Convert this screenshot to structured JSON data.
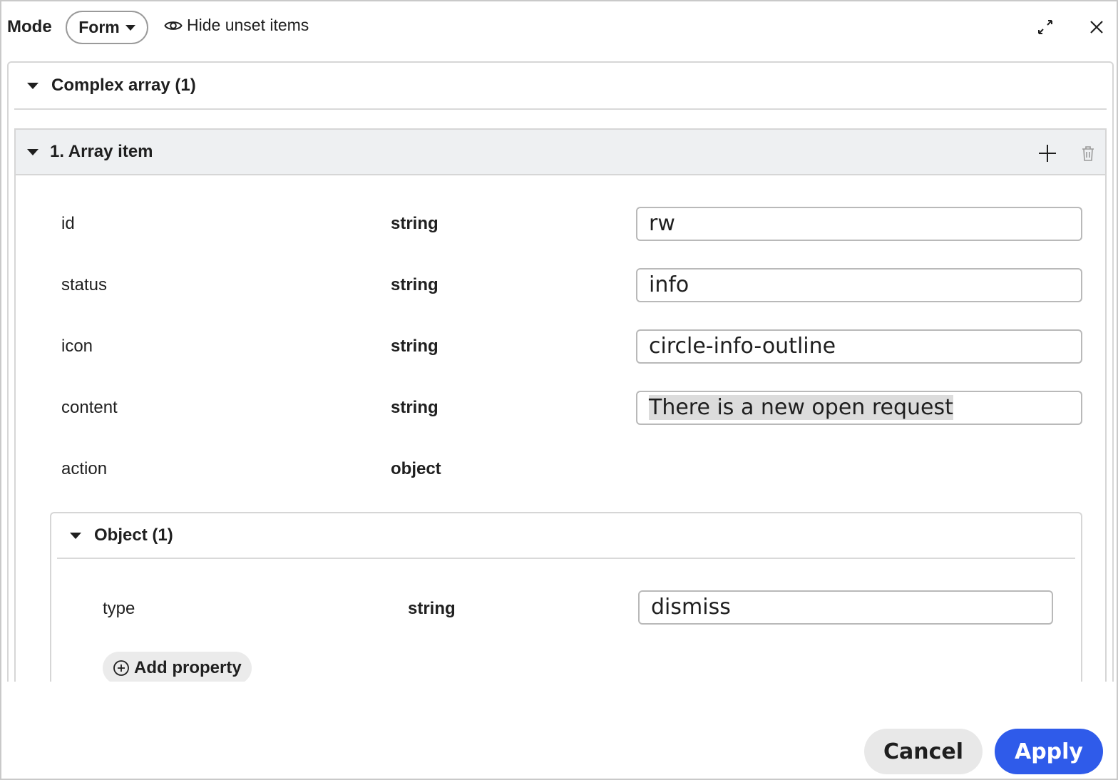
{
  "toolbar": {
    "mode_label": "Mode",
    "mode_value": "Form",
    "hide_unset_label": "Hide unset items"
  },
  "group": {
    "title": "Complex array (1)"
  },
  "item": {
    "title": "1. Array item",
    "properties": [
      {
        "name": "id",
        "type": "string",
        "value": "rw"
      },
      {
        "name": "status",
        "type": "string",
        "value": "info"
      },
      {
        "name": "icon",
        "type": "string",
        "value": "circle-info-outline"
      },
      {
        "name": "content",
        "type": "string",
        "value": "There is a new open request"
      },
      {
        "name": "action",
        "type": "object"
      }
    ]
  },
  "object": {
    "title": "Object (1)",
    "properties": [
      {
        "name": "type",
        "type": "string",
        "value": "dismiss"
      }
    ],
    "add_property_label": "Add property"
  },
  "footer": {
    "cancel_label": "Cancel",
    "apply_label": "Apply"
  },
  "colors": {
    "accent": "#2f5bea",
    "header_bg": "#eef0f2",
    "border": "#d6d6d6"
  }
}
